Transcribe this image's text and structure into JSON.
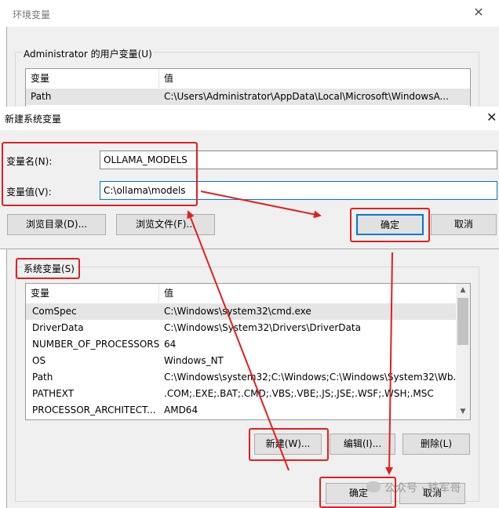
{
  "env_dialog": {
    "title": "环境变量",
    "close_glyph": "✕",
    "user_group_label": "Administrator 的用户变量(U)",
    "user_table": {
      "headers": [
        "变量",
        "值"
      ],
      "rows": [
        {
          "name": "Path",
          "value": "C:\\Users\\Administrator\\AppData\\Local\\Microsoft\\WindowsA..."
        }
      ]
    },
    "system_group_label": "系统变量(S)",
    "system_table": {
      "headers": [
        "变量",
        "值"
      ],
      "rows": [
        {
          "name": "ComSpec",
          "value": "C:\\Windows\\system32\\cmd.exe"
        },
        {
          "name": "DriverData",
          "value": "C:\\Windows\\System32\\Drivers\\DriverData"
        },
        {
          "name": "NUMBER_OF_PROCESSORS",
          "value": "64"
        },
        {
          "name": "OS",
          "value": "Windows_NT"
        },
        {
          "name": "Path",
          "value": "C:\\Windows\\system32;C:\\Windows;C:\\Windows\\System32\\Wb..."
        },
        {
          "name": "PATHEXT",
          "value": ".COM;.EXE;.BAT;.CMD;.VBS;.VBE;.JS;.JSE;.WSF;.WSH;.MSC"
        },
        {
          "name": "PROCESSOR_ARCHITECT...",
          "value": "AMD64"
        }
      ]
    },
    "buttons": {
      "new": "新建(W)...",
      "edit": "编辑(I)...",
      "delete": "删除(L)",
      "ok": "确定",
      "cancel": "取消"
    }
  },
  "new_var_dialog": {
    "title": "新建系统变量",
    "close_glyph": "✕",
    "name_label": "变量名(N):",
    "value_label": "变量值(V):",
    "name_value": "OLLAMA_MODELS",
    "value_value": "C:\\ollama\\models",
    "buttons": {
      "browse_dir": "浏览目录(D)...",
      "browse_file": "浏览文件(F)...",
      "ok": "确定",
      "cancel": "取消"
    }
  },
  "watermark": "公众号 · 铁军哥",
  "colors": {
    "annotation_red": "#e02020",
    "dialog_bg": "#f0f0f0",
    "focus_blue": "#0078d7"
  },
  "scrollbar": {
    "up_icon": "▲",
    "down_icon": "▼"
  }
}
